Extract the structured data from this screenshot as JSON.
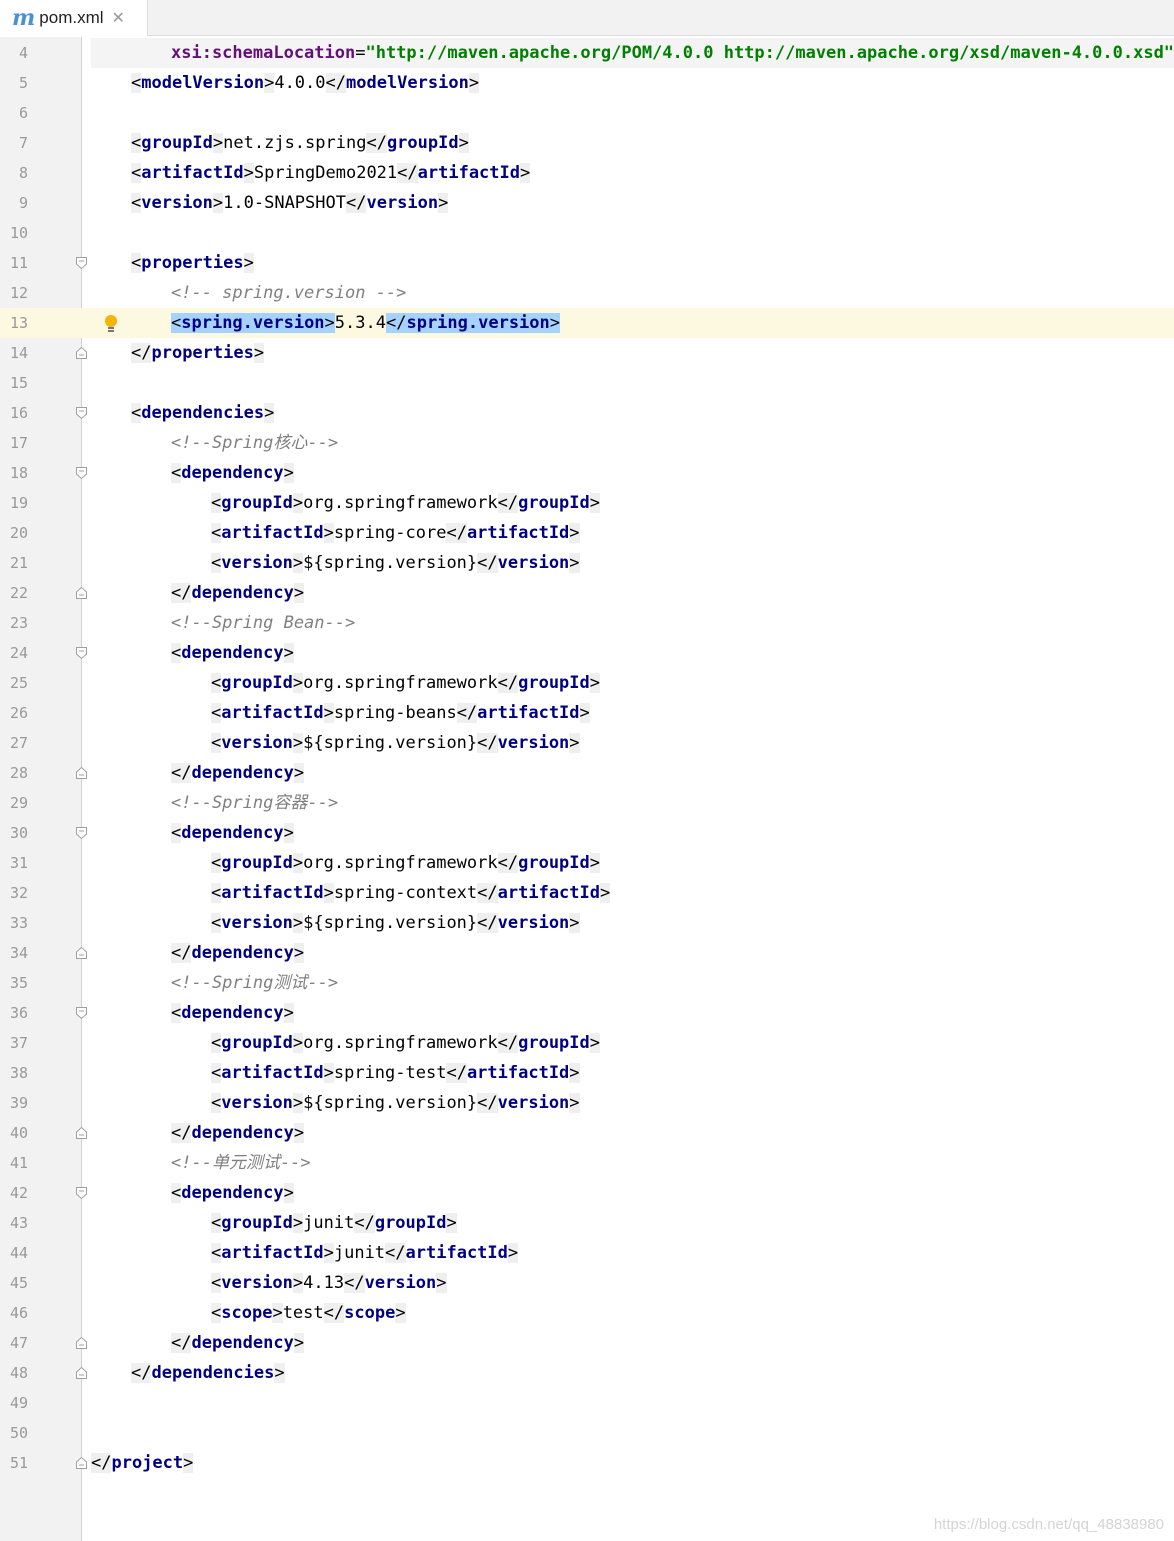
{
  "tab": {
    "filename": "pom.xml",
    "icon": "m"
  },
  "watermark": "https://blog.csdn.net/qq_48838980",
  "lines": [
    {
      "n": "4",
      "indent": 2,
      "segs": [
        {
          "c": "an",
          "t": "xsi:schemaLocation"
        },
        {
          "c": "tx",
          "t": "="
        },
        {
          "c": "av",
          "t": "\"http://maven.apache.org/POM/4.0.0 http://maven.apache.org/xsd/maven-4.0.0.xsd\""
        },
        {
          "c": "tx",
          "t": ">"
        }
      ],
      "shade": true
    },
    {
      "n": "5",
      "indent": 1,
      "segs": [
        {
          "c": "t",
          "t": "<"
        },
        {
          "c": "tn",
          "t": "modelVersion"
        },
        {
          "c": "t",
          "t": ">"
        },
        {
          "c": "tx",
          "t": "4.0.0"
        },
        {
          "c": "t",
          "t": "</"
        },
        {
          "c": "tn",
          "t": "modelVersion"
        },
        {
          "c": "t",
          "t": ">"
        }
      ]
    },
    {
      "n": "6",
      "indent": 0,
      "segs": []
    },
    {
      "n": "7",
      "indent": 1,
      "segs": [
        {
          "c": "t",
          "t": "<"
        },
        {
          "c": "tn",
          "t": "groupId"
        },
        {
          "c": "t",
          "t": ">"
        },
        {
          "c": "tx",
          "t": "net.zjs.spring"
        },
        {
          "c": "t",
          "t": "</"
        },
        {
          "c": "tn",
          "t": "groupId"
        },
        {
          "c": "t",
          "t": ">"
        }
      ]
    },
    {
      "n": "8",
      "indent": 1,
      "segs": [
        {
          "c": "t",
          "t": "<"
        },
        {
          "c": "tn",
          "t": "artifactId"
        },
        {
          "c": "t",
          "t": ">"
        },
        {
          "c": "tx",
          "t": "SpringDemo2021"
        },
        {
          "c": "t",
          "t": "</"
        },
        {
          "c": "tn",
          "t": "artifactId"
        },
        {
          "c": "t",
          "t": ">"
        }
      ]
    },
    {
      "n": "9",
      "indent": 1,
      "segs": [
        {
          "c": "t",
          "t": "<"
        },
        {
          "c": "tn",
          "t": "version"
        },
        {
          "c": "t",
          "t": ">"
        },
        {
          "c": "tx",
          "t": "1.0-SNAPSHOT"
        },
        {
          "c": "t",
          "t": "</"
        },
        {
          "c": "tn",
          "t": "version"
        },
        {
          "c": "t",
          "t": ">"
        }
      ]
    },
    {
      "n": "10",
      "indent": 0,
      "segs": []
    },
    {
      "n": "11",
      "indent": 1,
      "fold": "open",
      "segs": [
        {
          "c": "t",
          "t": "<"
        },
        {
          "c": "tn",
          "t": "properties"
        },
        {
          "c": "t",
          "t": ">"
        }
      ]
    },
    {
      "n": "12",
      "indent": 2,
      "segs": [
        {
          "c": "cm",
          "t": "<!-- spring.version -->"
        }
      ]
    },
    {
      "n": "13",
      "indent": 2,
      "current": true,
      "bulb": true,
      "segs": [
        {
          "c": "sel",
          "t": "<"
        },
        {
          "c": "sel tn",
          "t": "spring.version"
        },
        {
          "c": "sel",
          "t": ">"
        },
        {
          "c": "tx",
          "t": "5.3.4"
        },
        {
          "c": "sel",
          "t": "</"
        },
        {
          "c": "sel tn",
          "t": "spring.version"
        },
        {
          "c": "sel",
          "t": ">"
        }
      ]
    },
    {
      "n": "14",
      "indent": 1,
      "fold": "close",
      "segs": [
        {
          "c": "t",
          "t": "</"
        },
        {
          "c": "tn",
          "t": "properties"
        },
        {
          "c": "t",
          "t": ">"
        }
      ]
    },
    {
      "n": "15",
      "indent": 0,
      "segs": []
    },
    {
      "n": "16",
      "indent": 1,
      "fold": "open",
      "segs": [
        {
          "c": "t",
          "t": "<"
        },
        {
          "c": "tn",
          "t": "dependencies"
        },
        {
          "c": "t",
          "t": ">"
        }
      ]
    },
    {
      "n": "17",
      "indent": 2,
      "segs": [
        {
          "c": "cm",
          "t": "<!--Spring核心-->"
        }
      ]
    },
    {
      "n": "18",
      "indent": 2,
      "fold": "open",
      "segs": [
        {
          "c": "t",
          "t": "<"
        },
        {
          "c": "tn",
          "t": "dependency"
        },
        {
          "c": "t",
          "t": ">"
        }
      ]
    },
    {
      "n": "19",
      "indent": 3,
      "segs": [
        {
          "c": "t",
          "t": "<"
        },
        {
          "c": "tn",
          "t": "groupId"
        },
        {
          "c": "t",
          "t": ">"
        },
        {
          "c": "tx",
          "t": "org.springframework"
        },
        {
          "c": "t",
          "t": "</"
        },
        {
          "c": "tn",
          "t": "groupId"
        },
        {
          "c": "t",
          "t": ">"
        }
      ]
    },
    {
      "n": "20",
      "indent": 3,
      "segs": [
        {
          "c": "t",
          "t": "<"
        },
        {
          "c": "tn",
          "t": "artifactId"
        },
        {
          "c": "t",
          "t": ">"
        },
        {
          "c": "tx",
          "t": "spring-core"
        },
        {
          "c": "t",
          "t": "</"
        },
        {
          "c": "tn",
          "t": "artifactId"
        },
        {
          "c": "t",
          "t": ">"
        }
      ]
    },
    {
      "n": "21",
      "indent": 3,
      "segs": [
        {
          "c": "t",
          "t": "<"
        },
        {
          "c": "tn",
          "t": "version"
        },
        {
          "c": "t",
          "t": ">"
        },
        {
          "c": "tx",
          "t": "${spring.version}"
        },
        {
          "c": "t",
          "t": "</"
        },
        {
          "c": "tn",
          "t": "version"
        },
        {
          "c": "t",
          "t": ">"
        }
      ]
    },
    {
      "n": "22",
      "indent": 2,
      "fold": "close",
      "segs": [
        {
          "c": "t",
          "t": "</"
        },
        {
          "c": "tn",
          "t": "dependency"
        },
        {
          "c": "t",
          "t": ">"
        }
      ]
    },
    {
      "n": "23",
      "indent": 2,
      "segs": [
        {
          "c": "cm",
          "t": "<!--Spring Bean-->"
        }
      ]
    },
    {
      "n": "24",
      "indent": 2,
      "fold": "open",
      "segs": [
        {
          "c": "t",
          "t": "<"
        },
        {
          "c": "tn",
          "t": "dependency"
        },
        {
          "c": "t",
          "t": ">"
        }
      ]
    },
    {
      "n": "25",
      "indent": 3,
      "segs": [
        {
          "c": "t",
          "t": "<"
        },
        {
          "c": "tn",
          "t": "groupId"
        },
        {
          "c": "t",
          "t": ">"
        },
        {
          "c": "tx",
          "t": "org.springframework"
        },
        {
          "c": "t",
          "t": "</"
        },
        {
          "c": "tn",
          "t": "groupId"
        },
        {
          "c": "t",
          "t": ">"
        }
      ]
    },
    {
      "n": "26",
      "indent": 3,
      "segs": [
        {
          "c": "t",
          "t": "<"
        },
        {
          "c": "tn",
          "t": "artifactId"
        },
        {
          "c": "t",
          "t": ">"
        },
        {
          "c": "tx",
          "t": "spring-beans"
        },
        {
          "c": "t",
          "t": "</"
        },
        {
          "c": "tn",
          "t": "artifactId"
        },
        {
          "c": "t",
          "t": ">"
        }
      ]
    },
    {
      "n": "27",
      "indent": 3,
      "segs": [
        {
          "c": "t",
          "t": "<"
        },
        {
          "c": "tn",
          "t": "version"
        },
        {
          "c": "t",
          "t": ">"
        },
        {
          "c": "tx",
          "t": "${spring.version}"
        },
        {
          "c": "t",
          "t": "</"
        },
        {
          "c": "tn",
          "t": "version"
        },
        {
          "c": "t",
          "t": ">"
        }
      ]
    },
    {
      "n": "28",
      "indent": 2,
      "fold": "close",
      "segs": [
        {
          "c": "t",
          "t": "</"
        },
        {
          "c": "tn",
          "t": "dependency"
        },
        {
          "c": "t",
          "t": ">"
        }
      ]
    },
    {
      "n": "29",
      "indent": 2,
      "segs": [
        {
          "c": "cm",
          "t": "<!--Spring容器-->"
        }
      ]
    },
    {
      "n": "30",
      "indent": 2,
      "fold": "open",
      "segs": [
        {
          "c": "t",
          "t": "<"
        },
        {
          "c": "tn",
          "t": "dependency"
        },
        {
          "c": "t",
          "t": ">"
        }
      ]
    },
    {
      "n": "31",
      "indent": 3,
      "segs": [
        {
          "c": "t",
          "t": "<"
        },
        {
          "c": "tn",
          "t": "groupId"
        },
        {
          "c": "t",
          "t": ">"
        },
        {
          "c": "tx",
          "t": "org.springframework"
        },
        {
          "c": "t",
          "t": "</"
        },
        {
          "c": "tn",
          "t": "groupId"
        },
        {
          "c": "t",
          "t": ">"
        }
      ]
    },
    {
      "n": "32",
      "indent": 3,
      "segs": [
        {
          "c": "t",
          "t": "<"
        },
        {
          "c": "tn",
          "t": "artifactId"
        },
        {
          "c": "t",
          "t": ">"
        },
        {
          "c": "tx",
          "t": "spring-context"
        },
        {
          "c": "t",
          "t": "</"
        },
        {
          "c": "tn",
          "t": "artifactId"
        },
        {
          "c": "t",
          "t": ">"
        }
      ]
    },
    {
      "n": "33",
      "indent": 3,
      "segs": [
        {
          "c": "t",
          "t": "<"
        },
        {
          "c": "tn",
          "t": "version"
        },
        {
          "c": "t",
          "t": ">"
        },
        {
          "c": "tx",
          "t": "${spring.version}"
        },
        {
          "c": "t",
          "t": "</"
        },
        {
          "c": "tn",
          "t": "version"
        },
        {
          "c": "t",
          "t": ">"
        }
      ]
    },
    {
      "n": "34",
      "indent": 2,
      "fold": "close",
      "segs": [
        {
          "c": "t",
          "t": "</"
        },
        {
          "c": "tn",
          "t": "dependency"
        },
        {
          "c": "t",
          "t": ">"
        }
      ]
    },
    {
      "n": "35",
      "indent": 2,
      "segs": [
        {
          "c": "cm",
          "t": "<!--Spring测试-->"
        }
      ]
    },
    {
      "n": "36",
      "indent": 2,
      "fold": "open",
      "segs": [
        {
          "c": "t",
          "t": "<"
        },
        {
          "c": "tn",
          "t": "dependency"
        },
        {
          "c": "t",
          "t": ">"
        }
      ]
    },
    {
      "n": "37",
      "indent": 3,
      "segs": [
        {
          "c": "t",
          "t": "<"
        },
        {
          "c": "tn",
          "t": "groupId"
        },
        {
          "c": "t",
          "t": ">"
        },
        {
          "c": "tx",
          "t": "org.springframework"
        },
        {
          "c": "t",
          "t": "</"
        },
        {
          "c": "tn",
          "t": "groupId"
        },
        {
          "c": "t",
          "t": ">"
        }
      ]
    },
    {
      "n": "38",
      "indent": 3,
      "segs": [
        {
          "c": "t",
          "t": "<"
        },
        {
          "c": "tn",
          "t": "artifactId"
        },
        {
          "c": "t",
          "t": ">"
        },
        {
          "c": "tx",
          "t": "spring-test"
        },
        {
          "c": "t",
          "t": "</"
        },
        {
          "c": "tn",
          "t": "artifactId"
        },
        {
          "c": "t",
          "t": ">"
        }
      ]
    },
    {
      "n": "39",
      "indent": 3,
      "segs": [
        {
          "c": "t",
          "t": "<"
        },
        {
          "c": "tn",
          "t": "version"
        },
        {
          "c": "t",
          "t": ">"
        },
        {
          "c": "tx",
          "t": "${spring.version}"
        },
        {
          "c": "t",
          "t": "</"
        },
        {
          "c": "tn",
          "t": "version"
        },
        {
          "c": "t",
          "t": ">"
        }
      ]
    },
    {
      "n": "40",
      "indent": 2,
      "fold": "close",
      "segs": [
        {
          "c": "t",
          "t": "</"
        },
        {
          "c": "tn",
          "t": "dependency"
        },
        {
          "c": "t",
          "t": ">"
        }
      ]
    },
    {
      "n": "41",
      "indent": 2,
      "segs": [
        {
          "c": "cm",
          "t": "<!--单元测试-->"
        }
      ]
    },
    {
      "n": "42",
      "indent": 2,
      "fold": "open",
      "segs": [
        {
          "c": "t",
          "t": "<"
        },
        {
          "c": "tn",
          "t": "dependency"
        },
        {
          "c": "t",
          "t": ">"
        }
      ]
    },
    {
      "n": "43",
      "indent": 3,
      "segs": [
        {
          "c": "t",
          "t": "<"
        },
        {
          "c": "tn",
          "t": "groupId"
        },
        {
          "c": "t",
          "t": ">"
        },
        {
          "c": "tx",
          "t": "junit"
        },
        {
          "c": "t",
          "t": "</"
        },
        {
          "c": "tn",
          "t": "groupId"
        },
        {
          "c": "t",
          "t": ">"
        }
      ]
    },
    {
      "n": "44",
      "indent": 3,
      "segs": [
        {
          "c": "t",
          "t": "<"
        },
        {
          "c": "tn",
          "t": "artifactId"
        },
        {
          "c": "t",
          "t": ">"
        },
        {
          "c": "tx",
          "t": "junit"
        },
        {
          "c": "t",
          "t": "</"
        },
        {
          "c": "tn",
          "t": "artifactId"
        },
        {
          "c": "t",
          "t": ">"
        }
      ]
    },
    {
      "n": "45",
      "indent": 3,
      "segs": [
        {
          "c": "t",
          "t": "<"
        },
        {
          "c": "tn",
          "t": "version"
        },
        {
          "c": "t",
          "t": ">"
        },
        {
          "c": "tx",
          "t": "4.13"
        },
        {
          "c": "t",
          "t": "</"
        },
        {
          "c": "tn",
          "t": "version"
        },
        {
          "c": "t",
          "t": ">"
        }
      ]
    },
    {
      "n": "46",
      "indent": 3,
      "segs": [
        {
          "c": "t",
          "t": "<"
        },
        {
          "c": "tn",
          "t": "scope"
        },
        {
          "c": "t",
          "t": ">"
        },
        {
          "c": "tx",
          "t": "test"
        },
        {
          "c": "t",
          "t": "</"
        },
        {
          "c": "tn",
          "t": "scope"
        },
        {
          "c": "t",
          "t": ">"
        }
      ]
    },
    {
      "n": "47",
      "indent": 2,
      "fold": "close",
      "segs": [
        {
          "c": "t",
          "t": "</"
        },
        {
          "c": "tn",
          "t": "dependency"
        },
        {
          "c": "t",
          "t": ">"
        }
      ]
    },
    {
      "n": "48",
      "indent": 1,
      "fold": "close",
      "segs": [
        {
          "c": "t",
          "t": "</"
        },
        {
          "c": "tn",
          "t": "dependencies"
        },
        {
          "c": "t",
          "t": ">"
        }
      ]
    },
    {
      "n": "49",
      "indent": 0,
      "segs": []
    },
    {
      "n": "50",
      "indent": 0,
      "segs": []
    },
    {
      "n": "51",
      "indent": 0,
      "fold": "close",
      "segs": [
        {
          "c": "t",
          "t": "</"
        },
        {
          "c": "tn",
          "t": "project"
        },
        {
          "c": "t",
          "t": ">"
        }
      ]
    }
  ]
}
